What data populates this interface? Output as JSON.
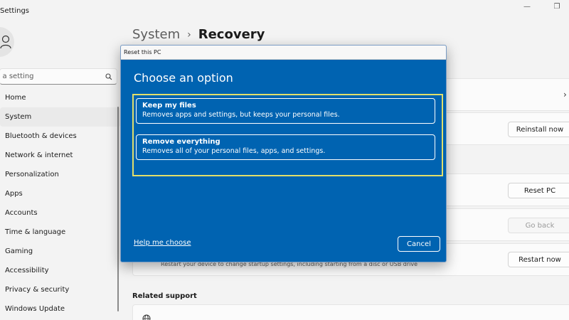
{
  "app": {
    "title": "Settings"
  },
  "window_controls": {
    "minimize": "—",
    "maximize": "❐"
  },
  "search": {
    "placeholder": "d a setting"
  },
  "nav": {
    "items": [
      {
        "label": "Home"
      },
      {
        "label": "System"
      },
      {
        "label": "Bluetooth & devices"
      },
      {
        "label": "Network & internet"
      },
      {
        "label": "Personalization"
      },
      {
        "label": "Apps"
      },
      {
        "label": "Accounts"
      },
      {
        "label": "Time & language"
      },
      {
        "label": "Gaming"
      },
      {
        "label": "Accessibility"
      },
      {
        "label": "Privacy & security"
      },
      {
        "label": "Windows Update"
      }
    ],
    "active_index": 1
  },
  "breadcrumb": {
    "parent": "System",
    "separator": "›",
    "current": "Recovery"
  },
  "background": {
    "reinstall_label": "Reinstall now",
    "reset_label": "Reset PC",
    "goback_label": "Go back",
    "restart_label": "Restart now",
    "advanced_desc": "Restart your device to change startup settings, including starting from a disc or USB drive",
    "related_support": "Related support",
    "chevron": "›"
  },
  "dialog": {
    "title": "Reset this PC",
    "heading": "Choose an option",
    "options": [
      {
        "title": "Keep my files",
        "desc": "Removes apps and settings, but keeps your personal files."
      },
      {
        "title": "Remove everything",
        "desc": "Removes all of your personal files, apps, and settings."
      }
    ],
    "help_link": "Help me choose",
    "cancel_label": "Cancel"
  },
  "colors": {
    "dialog_bg": "#0063b1",
    "focus_frame": "#e3df6a"
  }
}
